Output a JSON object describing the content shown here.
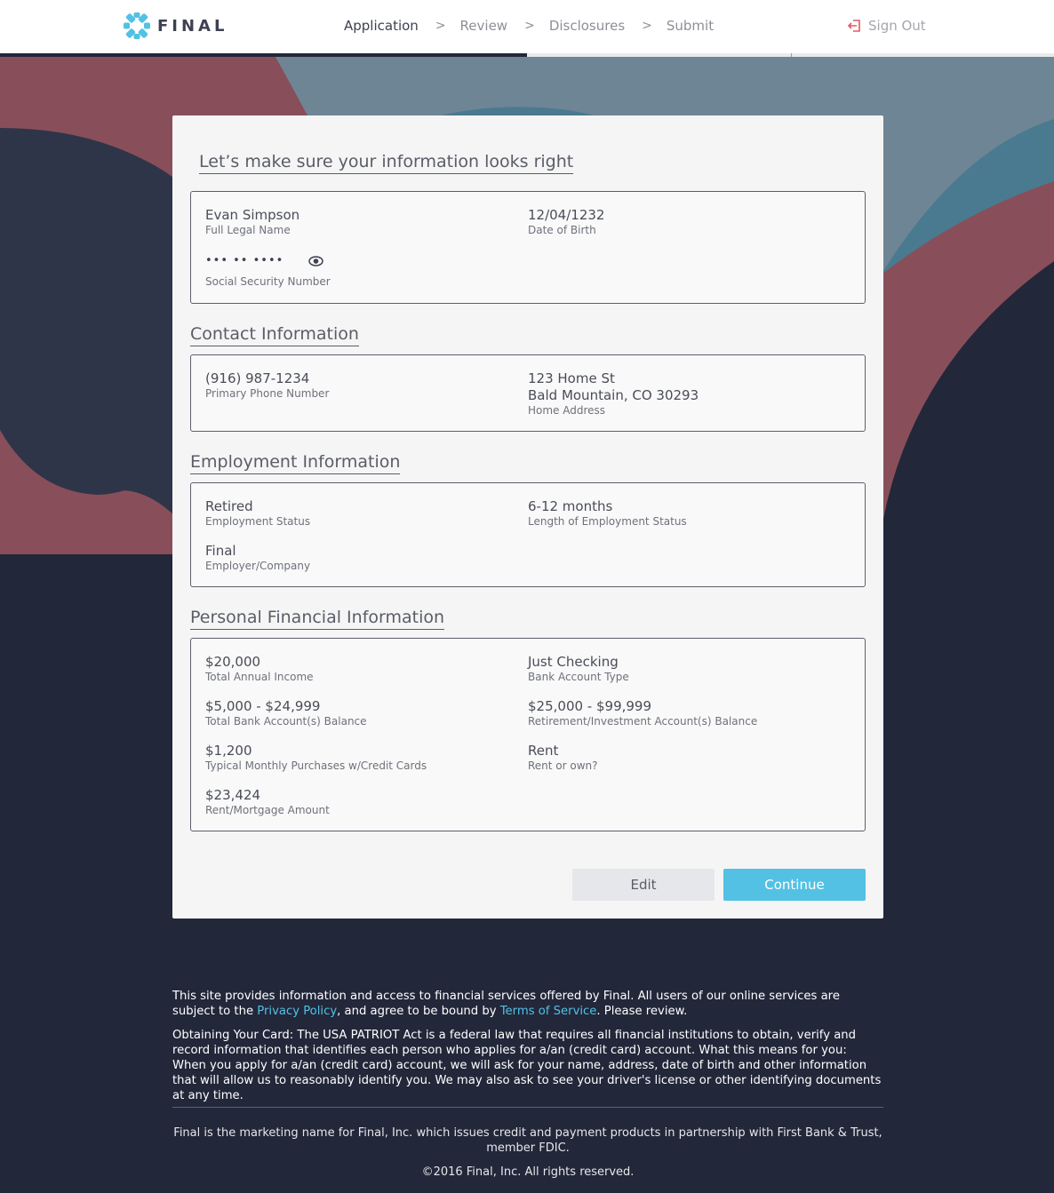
{
  "header": {
    "brand": "FINAL",
    "steps": [
      {
        "label": "Application",
        "active": true
      },
      {
        "label": "Review",
        "active": false
      },
      {
        "label": "Disclosures",
        "active": false
      },
      {
        "label": "Submit",
        "active": false
      }
    ],
    "separator": ">",
    "sign_out_label": "Sign Out"
  },
  "progress": {
    "completed_fraction": 0.5,
    "segments": 4
  },
  "colors": {
    "accent": "#53c1e3",
    "dark_navy": "#22273a",
    "signout_icon": "#e25a63",
    "bg_maroon": "#884f5a",
    "bg_slate": "#6e8595",
    "bg_teal": "#4a7a90"
  },
  "main": {
    "title": "Let’s make sure your information looks right",
    "identity": {
      "full_name": {
        "value": "Evan Simpson",
        "label": "Full Legal Name"
      },
      "dob": {
        "value": "12/04/1232",
        "label": "Date of Birth"
      },
      "ssn": {
        "value": "••• •• ••••",
        "label": "Social Security Number",
        "icon": "eye-icon"
      }
    },
    "contact": {
      "title": "Contact Information",
      "phone": {
        "value": "(916) 987-1234",
        "label": "Primary Phone Number"
      },
      "address": {
        "line1": "123 Home St",
        "line2": "Bald Mountain, CO 30293",
        "label": "Home Address"
      }
    },
    "employment": {
      "title": "Employment Information",
      "status": {
        "value": "Retired",
        "label": "Employment Status"
      },
      "length": {
        "value": "6-12 months",
        "label": "Length of Employment Status"
      },
      "employer": {
        "value": "Final",
        "label": "Employer/Company"
      }
    },
    "financial": {
      "title": "Personal Financial Information",
      "income": {
        "value": "$20,000",
        "label": "Total Annual Income"
      },
      "account_type": {
        "value": "Just Checking",
        "label": "Bank Account Type"
      },
      "bank_balance": {
        "value": "$5,000 - $24,999",
        "label": "Total Bank Account(s) Balance"
      },
      "retirement_balance": {
        "value": "$25,000 - $99,999",
        "label": "Retirement/Investment Account(s) Balance"
      },
      "monthly_purchases": {
        "value": "$1,200",
        "label": "Typical Monthly Purchases w/Credit Cards"
      },
      "rent_own": {
        "value": "Rent",
        "label": "Rent or own?"
      },
      "rent_amount": {
        "value": "$23,424",
        "label": "Rent/Mortgage Amount"
      }
    },
    "buttons": {
      "edit": "Edit",
      "continue": "Continue"
    }
  },
  "footer": {
    "p1_a": "This site provides information and access to financial services offered by Final. All users of our online services are subject to the ",
    "privacy_link": "Privacy Policy",
    "p1_b": ", and agree to be bound by ",
    "terms_link": "Terms of Service",
    "p1_c": ". Please review.",
    "p2": "Obtaining Your Card: The USA PATRIOT Act is a federal law that requires all financial institutions to obtain, verify and record information that identifies each person who applies for a/an (credit card) account. What this means for you: When you apply for a/an (credit card) account, we will ask for your name, address, date of birth and other information that will allow us to reasonably identify you. We may also ask to see your driver's license or other identifying documents at any time.",
    "marketing": "Final is the marketing name for Final, Inc. which issues credit and payment products in partnership with First Bank & Trust, member FDIC.",
    "copyright": "©2016 Final, Inc. All rights reserved."
  }
}
